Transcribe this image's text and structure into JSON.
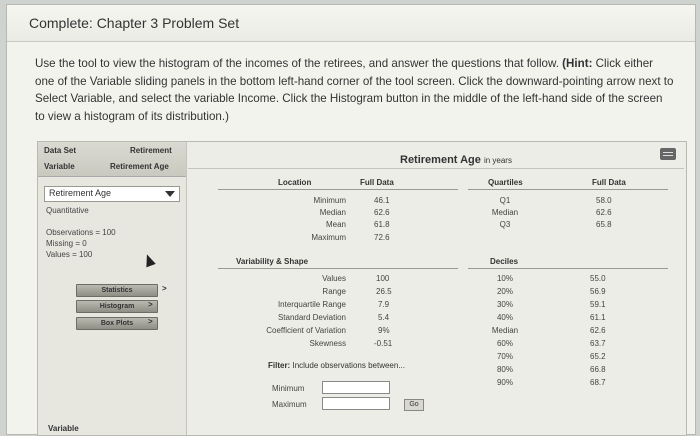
{
  "header": {
    "title": "Complete: Chapter 3 Problem Set"
  },
  "instructions": {
    "text_before_hint": "Use the tool to view the histogram of the incomes of the retirees, and answer the questions that follow.",
    "hint_label": "(Hint:",
    "text_after_hint": "Click either one of the Variable sliding panels in the bottom left-hand corner of the tool screen. Click the downward-pointing arrow next to Select Variable, and select the variable Income. Click the Histogram button in the middle of the left-hand side of the screen to view a histogram of its distribution.)"
  },
  "left_panel": {
    "data_set_label": "Data Set",
    "data_set_value": "Retirement",
    "variable_label": "Variable",
    "variable_value": "Retirement Age",
    "select_value": "Retirement Age",
    "var_type": "Quantitative",
    "observations": "Observations = 100",
    "missing": "Missing = 0",
    "values": "Values = 100",
    "buttons": {
      "statistics": "Statistics",
      "histogram": "Histogram",
      "box_plots": "Box Plots"
    },
    "chevron": ">",
    "footer_variable": "Variable"
  },
  "right_panel": {
    "title": "Retirement Age",
    "title_suffix": "in years",
    "location": {
      "header": "Location",
      "col_header": "Full Data",
      "rows": [
        {
          "label": "Minimum",
          "value": "46.1"
        },
        {
          "label": "Median",
          "value": "62.6"
        },
        {
          "label": "Mean",
          "value": "61.8"
        },
        {
          "label": "Maximum",
          "value": "72.6"
        }
      ]
    },
    "quartiles": {
      "header": "Quartiles",
      "col_header": "Full Data",
      "rows": [
        {
          "label": "Q1",
          "value": "58.0"
        },
        {
          "label": "Median",
          "value": "62.6"
        },
        {
          "label": "Q3",
          "value": "65.8"
        }
      ]
    },
    "variability": {
      "header": "Variability & Shape",
      "rows": [
        {
          "label": "Values",
          "value": "100"
        },
        {
          "label": "Range",
          "value": "26.5"
        },
        {
          "label": "Interquartile Range",
          "value": "7.9"
        },
        {
          "label": "Standard Deviation",
          "value": "5.4"
        },
        {
          "label": "Coefficient of Variation",
          "value": "9%"
        },
        {
          "label": "Skewness",
          "value": "-0.51"
        }
      ]
    },
    "deciles": {
      "header": "Deciles",
      "rows": [
        {
          "label": "10%",
          "value": "55.0"
        },
        {
          "label": "20%",
          "value": "56.9"
        },
        {
          "label": "30%",
          "value": "59.1"
        },
        {
          "label": "40%",
          "value": "61.1"
        },
        {
          "label": "Median",
          "value": "62.6"
        },
        {
          "label": "60%",
          "value": "63.7"
        },
        {
          "label": "70%",
          "value": "65.2"
        },
        {
          "label": "80%",
          "value": "66.8"
        },
        {
          "label": "90%",
          "value": "68.7"
        }
      ]
    },
    "filter": {
      "label_prefix": "Filter:",
      "label_text": "Include observations between...",
      "minimum_label": "Minimum",
      "maximum_label": "Maximum",
      "go_label": "Go"
    }
  }
}
